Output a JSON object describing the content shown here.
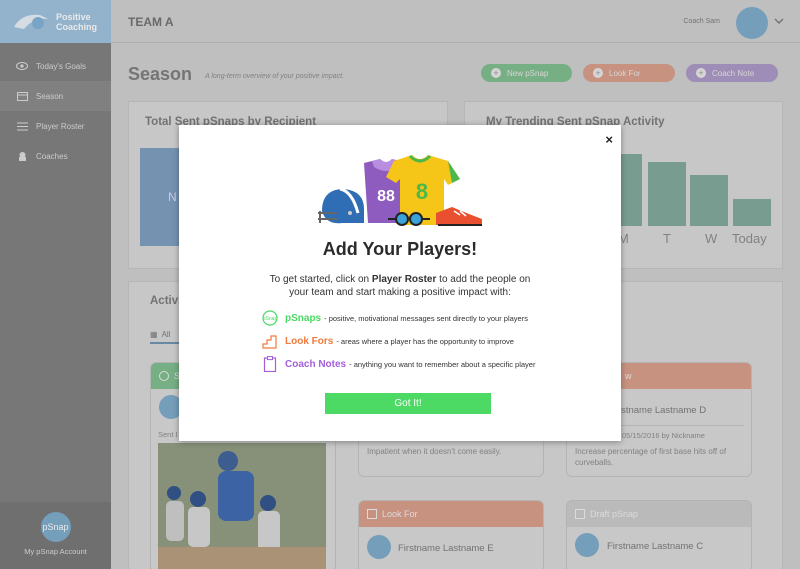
{
  "app": {
    "logo_line1": "Positive",
    "logo_line2": "Coaching"
  },
  "sidebar": {
    "items": [
      {
        "label": "Today's Goals",
        "icon": "eye-icon"
      },
      {
        "label": "Season",
        "icon": "calendar-icon",
        "active": true
      },
      {
        "label": "Player Roster",
        "icon": "list-icon"
      },
      {
        "label": "Coaches",
        "icon": "whistle-icon"
      }
    ],
    "account_avatar": "pSnap",
    "account_label": "My pSnap Account"
  },
  "header": {
    "team": "TEAM A",
    "coach": "Coach Sam"
  },
  "season": {
    "title": "Season",
    "subtitle": "A long-term overview of your positive impact.",
    "buttons": {
      "new_psnap": "New pSnap",
      "look_for": "Look For",
      "coach_note": "Coach Note"
    }
  },
  "panels": {
    "recipients_title": "Total Sent pSnaps by Recipient",
    "recipients_placeholder": "N",
    "trending_title": "My Trending Sent pSnap Activity",
    "trending_labels": [
      "M",
      "T",
      "W",
      "Today"
    ],
    "activity_title": "Activi",
    "activity_tab": "All"
  },
  "chart_data": {
    "type": "bar",
    "title": "My Trending Sent pSnap Activity",
    "categories": [
      "M",
      "T",
      "W",
      "Today"
    ],
    "values": [
      70,
      62,
      50,
      26
    ]
  },
  "cards": {
    "card1_head": "S",
    "card1_meta": "Sent I",
    "card2_body": "Impatient when it doesn't come easily.",
    "card3_head": "w",
    "card3_name": "Firstname Lastname D",
    "card3_meta": "05/15/2016 by Nickname",
    "card3_body": "Increase percentage of first base hits off of curveballs.",
    "card4_head": "Look For",
    "card4_name": "Firstname Lastname E",
    "card5_head": "Draft pSnap",
    "card5_name": "Firstname Lastname C"
  },
  "modal": {
    "title": "Add Your Players!",
    "intro_before": "To get started, click on ",
    "intro_bold": "Player Roster",
    "intro_after": " to add the people on your team and start making a positive impact with:",
    "features": [
      {
        "name": "pSnaps",
        "desc": " - positive, motivational messages sent directly to your players",
        "color": "#4cd964",
        "icon": "psnap-icon"
      },
      {
        "name": "Look Fors",
        "desc": " - areas where a player has the opportunity to improve",
        "color": "#f07a3c",
        "icon": "stairs-icon"
      },
      {
        "name": "Coach Notes",
        "desc": " - anything you want to remember about a specific player",
        "color": "#a45fd8",
        "icon": "clipboard-icon"
      }
    ],
    "jersey_numbers": [
      "88",
      "8"
    ],
    "button": "Got It!",
    "close": "×"
  },
  "colors": {
    "green": "#4cd964",
    "orange": "#f07a3c",
    "purple": "#a45fd8",
    "brand_blue": "#9dc0dc"
  }
}
